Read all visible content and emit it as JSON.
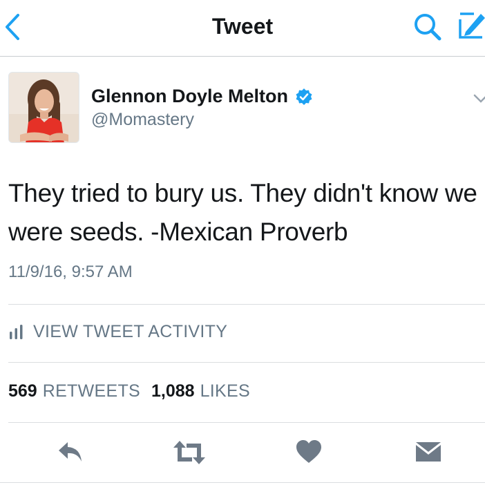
{
  "navbar": {
    "title": "Tweet",
    "back_icon": "chevron-left-icon",
    "search_icon": "search-icon",
    "compose_icon": "compose-icon"
  },
  "author": {
    "name": "Glennon Doyle Melton",
    "handle": "@Momastery",
    "verified": true
  },
  "tweet": {
    "text": "They tried to bury us. They didn't know we were seeds. -Mexican Proverb",
    "timestamp": "11/9/16, 9:57 AM"
  },
  "activity": {
    "label": "VIEW TWEET ACTIVITY"
  },
  "stats": {
    "retweets_count": "569",
    "retweets_label": "RETWEETS",
    "likes_count": "1,088",
    "likes_label": "LIKES"
  },
  "actions": [
    "reply-icon",
    "retweet-icon",
    "like-icon",
    "direct-message-icon"
  ],
  "colors": {
    "accent": "#1da1f2",
    "text": "#14171a",
    "secondary": "#657786",
    "action_icon": "#6e7a87"
  }
}
